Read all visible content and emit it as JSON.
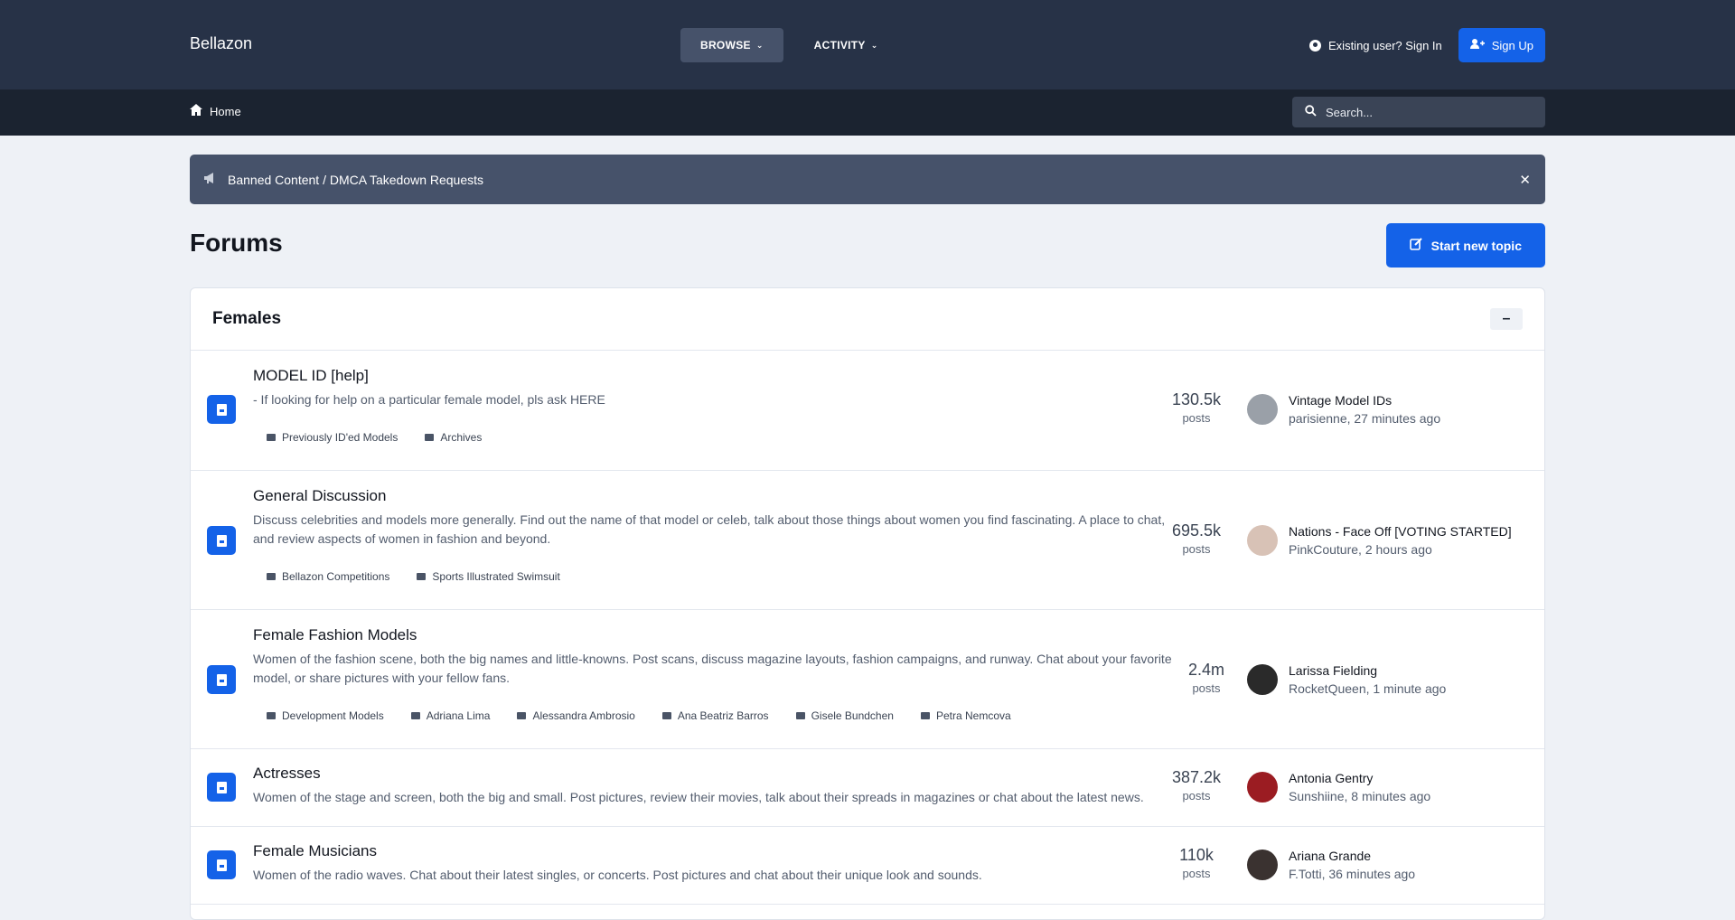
{
  "header": {
    "brand": "Bellazon",
    "nav": [
      {
        "label": "BROWSE"
      },
      {
        "label": "ACTIVITY"
      }
    ],
    "signin": "Existing user? Sign In",
    "signup": "Sign Up"
  },
  "subbar": {
    "home": "Home",
    "search_placeholder": "Search..."
  },
  "announcement": "Banned Content / DMCA Takedown Requests",
  "page_title": "Forums",
  "new_topic": "Start new topic",
  "category": {
    "title": "Females",
    "forums": [
      {
        "title": "MODEL ID [help]",
        "desc": "- If looking for help on a particular female model, pls ask HERE",
        "subforums": [
          "Previously ID'ed Models",
          "Archives"
        ],
        "posts": "130.5k",
        "posts_label": "posts",
        "last_title": "Vintage Model IDs",
        "last_meta": "parisienne, 27 minutes ago",
        "avatar_color": "#9aa0a8"
      },
      {
        "title": "General Discussion",
        "desc": "Discuss celebrities and models more generally. Find out the name of that model or celeb, talk about those things about women you find fascinating. A place to chat, and review aspects of women in fashion and beyond.",
        "subforums": [
          "Bellazon Competitions",
          "Sports Illustrated Swimsuit"
        ],
        "posts": "695.5k",
        "posts_label": "posts",
        "last_title": "Nations - Face Off [VOTING STARTED]",
        "last_meta": "PinkCouture, 2 hours ago",
        "avatar_color": "#d8c2b6"
      },
      {
        "title": "Female Fashion Models",
        "desc": "Women of the fashion scene, both the big names and little-knowns. Post scans, discuss magazine layouts, fashion campaigns, and runway. Chat about your favorite model, or share pictures with your fellow fans.",
        "subforums": [
          "Development Models",
          "Adriana Lima",
          "Alessandra Ambrosio",
          "Ana Beatriz Barros",
          "Gisele Bundchen",
          "Petra Nemcova"
        ],
        "posts": "2.4m",
        "posts_label": "posts",
        "last_title": "Larissa Fielding",
        "last_meta": "RocketQueen, 1 minute ago",
        "avatar_color": "#2a2a2a"
      },
      {
        "title": "Actresses",
        "desc": "Women of the stage and screen, both the big and small. Post pictures, review their movies, talk about their spreads in magazines or chat about the latest news.",
        "subforums": [],
        "posts": "387.2k",
        "posts_label": "posts",
        "last_title": "Antonia Gentry",
        "last_meta": "Sunshiine, 8 minutes ago",
        "avatar_color": "#9b1c22"
      },
      {
        "title": "Female Musicians",
        "desc": "Women of the radio waves. Chat about their latest singles, or concerts. Post pictures and chat about their unique look and sounds.",
        "subforums": [],
        "posts": "110k",
        "posts_label": "posts",
        "last_title": "Ariana Grande",
        "last_meta": "F.Totti, 36 minutes ago",
        "avatar_color": "#3a3230"
      }
    ]
  }
}
